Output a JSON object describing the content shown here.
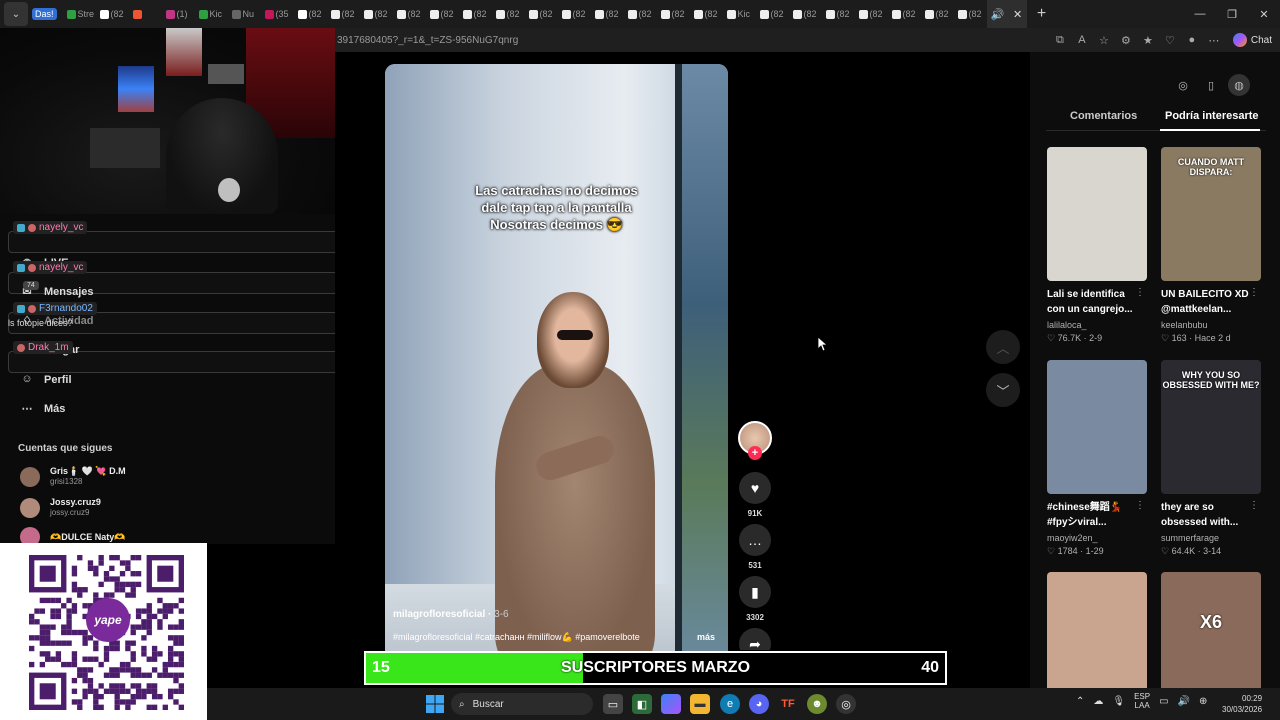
{
  "browser": {
    "tab_badge": "Das!",
    "tab_labels": [
      "Stre",
      "(82",
      "",
      "(1)",
      "Kic",
      "Nu",
      "(35",
      "(82",
      "(82",
      "(82",
      "(82",
      "(82",
      "(82",
      "(82",
      "(82",
      "(82",
      "(82",
      "(82",
      "(82",
      "(82",
      "Kic",
      "(82",
      "(82",
      "(82",
      "(82",
      "(82",
      "(82",
      "(82"
    ],
    "active_tab_icons": [
      "speaker",
      "close"
    ],
    "url": "3917680405?_r=1&_t=ZS-956NuG7qnrg",
    "chat_label": "Chat",
    "icons": [
      "chevron-down-icon",
      "new-tab-icon",
      "minimize-icon",
      "maximize-icon",
      "close-icon"
    ]
  },
  "stream_chat": {
    "users": [
      "nayely_vc",
      "nayely_vc",
      "F3rnando02",
      "Drak_1m"
    ],
    "message": "ls fotopie dices?",
    "badge": "74"
  },
  "tiktok_nav": {
    "items": [
      {
        "label": "LIVE",
        "icon": "live-icon"
      },
      {
        "label": "Mensajes",
        "icon": "message-icon"
      },
      {
        "label": "Actividad",
        "icon": "activity-icon"
      },
      {
        "label": "Cargar",
        "icon": "upload-icon"
      },
      {
        "label": "Perfil",
        "icon": "profile-icon"
      },
      {
        "label": "Más",
        "icon": "more-icon"
      }
    ],
    "following_title": "Cuentas que sigues",
    "following": [
      {
        "name": "Gris🕯️ 🤍 💘 D.M",
        "handle": "grisi1328"
      },
      {
        "name": "Jossy.cruz9",
        "handle": "jossy.cruz9"
      },
      {
        "name": "🫶DULCE Naty🫶",
        "handle": ""
      }
    ]
  },
  "qr": {
    "brand": "yape"
  },
  "video": {
    "caption_lines": [
      "Las catrachas no decimos",
      "dale tap tap a la pantalla",
      "Nosotras decimos 😎"
    ],
    "author": "milagrofloresoficial",
    "date": "3-6",
    "tags": "#milagrofloresoficial #catrachaнн #miliflow💪 #pamoverelbote",
    "more": "más",
    "likes": "91K",
    "comments": "531",
    "saves": "3302"
  },
  "right_panel": {
    "tabs": [
      "Comentarios",
      "Podría interesarte"
    ],
    "active_tab": 1,
    "cards": [
      {
        "title": "Lali se identifica con un cangrejo...",
        "author": "lalilaloca_",
        "likes": "76.7K",
        "date": "2-9",
        "overlay": "",
        "thumb_color": "#d9d5cf"
      },
      {
        "title": "UN BAILECITO XD @mattkeelan...",
        "author": "keelanbubu",
        "likes": "163",
        "date": "Hace 2 d",
        "overlay": "CUANDO MATT DISPARA:",
        "thumb_color": "#8a7a62"
      },
      {
        "title": "#chinese舞蹈💃 #fpyシviral...",
        "author": "maoyiw2en_",
        "likes": "1784",
        "date": "1-29",
        "overlay": "",
        "thumb_color": "#7a8aa0"
      },
      {
        "title": "they are so obsessed with...",
        "author": "summerfarage",
        "likes": "64.4K",
        "date": "3-14",
        "overlay": "WHY YOU SO OBSESSED WITH ME?",
        "thumb_color": "#2a2a30"
      },
      {
        "title": "",
        "author": "",
        "likes": "",
        "date": "",
        "overlay": "",
        "thumb_color": "#c9a590"
      },
      {
        "title": "",
        "author": "",
        "likes": "",
        "date": "",
        "overlay": "X6",
        "thumb_color": "#8a6a5a"
      }
    ]
  },
  "subs_bar": {
    "left": "15",
    "title": "SUSCRIPTORES MARZO",
    "right": "40",
    "progress": 0.375,
    "fill_color": "#39e61a"
  },
  "taskbar": {
    "search_placeholder": "Buscar",
    "lang_top": "ESP",
    "lang_bottom": "LAA",
    "time": "00:29",
    "date": "30/03/2026"
  }
}
